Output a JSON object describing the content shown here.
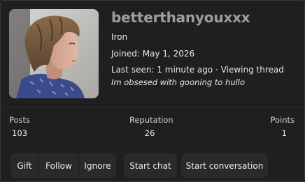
{
  "profile": {
    "username": "betterthanyouxxx",
    "rank": "Iron",
    "joined_label": "Joined:",
    "joined_date": "May 1, 2026",
    "last_seen_label": "Last seen:",
    "last_seen_value": "1 minute ago",
    "separator": "·",
    "activity_text": "Viewing thread",
    "thread_title": "Im obsesed with gooning to hullo"
  },
  "stats": {
    "posts_label": "Posts",
    "posts_value": "103",
    "reputation_label": "Reputation",
    "reputation_value": "26",
    "points_label": "Points",
    "points_value": "1"
  },
  "actions": {
    "gift": "Gift",
    "follow": "Follow",
    "ignore": "Ignore",
    "start_chat": "Start chat",
    "start_conversation": "Start conversation"
  },
  "colors": {
    "background": "#1b1b1b",
    "username": "#9d9d9d",
    "button_bg": "#2a2a2a",
    "text": "#e8e8e8"
  }
}
